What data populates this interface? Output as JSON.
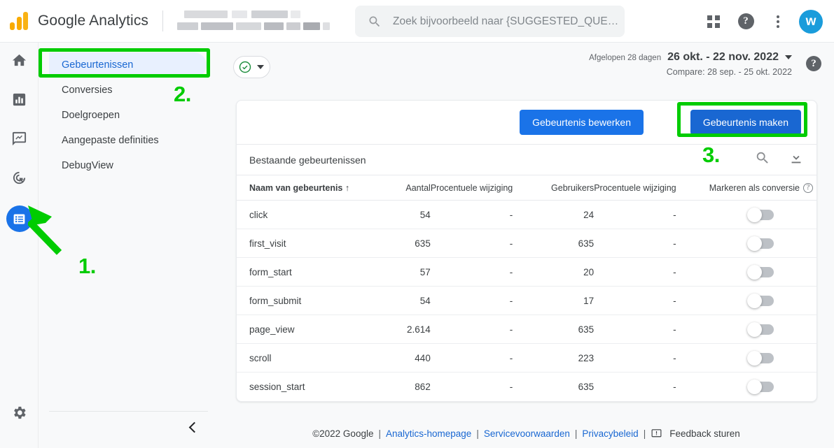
{
  "header": {
    "product_title": "Google Analytics",
    "logo_icon": "google-analytics-logo",
    "account_blurred": true,
    "search": {
      "icon": "search-icon",
      "placeholder": "Zoek bijvoorbeeld naar {SUGGESTED_QUE…"
    },
    "apps_icon": "apps-grid-icon",
    "help_icon": "help-circle-icon",
    "more_icon": "more-vertical-icon",
    "avatar_initial": "w",
    "avatar_color": "#1a9cdb"
  },
  "rail": {
    "items": [
      {
        "name": "home",
        "icon": "home-icon",
        "active": false
      },
      {
        "name": "reports",
        "icon": "bar-chart-icon",
        "active": false
      },
      {
        "name": "explore",
        "icon": "explore-trend-icon",
        "active": false
      },
      {
        "name": "advertising",
        "icon": "advertising-target-icon",
        "active": false
      },
      {
        "name": "configure",
        "icon": "list-config-icon",
        "active": true
      }
    ],
    "settings_icon": "gear-icon",
    "active_color": "#1a73e8"
  },
  "nav": {
    "items": [
      {
        "label": "Gebeurtenissen",
        "active": true
      },
      {
        "label": "Conversies",
        "active": false
      },
      {
        "label": "Doelgroepen",
        "active": false
      },
      {
        "label": "Aangepaste definities",
        "active": false
      },
      {
        "label": "DebugView",
        "active": false
      }
    ],
    "collapse_icon": "chevron-left-icon",
    "active_bg": "#e8f0fe",
    "active_text": "#1967d2"
  },
  "toolbar": {
    "filter_chip": {
      "check_icon": "check-circle-icon",
      "dropdown_icon": "chevron-down-icon"
    },
    "date_range": {
      "preset_label": "Afgelopen 28 dagen",
      "range": "26 okt. - 22 nov. 2022",
      "dropdown_icon": "chevron-down-icon",
      "compare": "Compare: 28 sep. - 25 okt. 2022"
    },
    "help_icon": "help-circle-icon"
  },
  "card": {
    "edit_event_button": "Gebeurtenis bewerken",
    "create_event_button": "Gebeurtenis maken",
    "section_title": "Bestaande gebeurtenissen",
    "search_icon": "search-icon",
    "download_icon": "download-icon",
    "button_primary_color": "#1a73e8",
    "button_secondary_color": "#1967d2"
  },
  "table": {
    "columns": [
      "Naam van gebeurtenis",
      "Aantal",
      "Procentuele wijziging",
      "Gebruikers",
      "Procentuele wijziging",
      "Markeren als conversie"
    ],
    "sort_icon": "arrow-up-icon",
    "conversion_help_icon": "question-badge-icon",
    "rows": [
      {
        "name": "click",
        "count": "54",
        "change1": "-",
        "users": "24",
        "change2": "-",
        "conversion": false
      },
      {
        "name": "first_visit",
        "count": "635",
        "change1": "-",
        "users": "635",
        "change2": "-",
        "conversion": false
      },
      {
        "name": "form_start",
        "count": "57",
        "change1": "-",
        "users": "20",
        "change2": "-",
        "conversion": false
      },
      {
        "name": "form_submit",
        "count": "54",
        "change1": "-",
        "users": "17",
        "change2": "-",
        "conversion": false
      },
      {
        "name": "page_view",
        "count": "2.614",
        "change1": "-",
        "users": "635",
        "change2": "-",
        "conversion": false
      },
      {
        "name": "scroll",
        "count": "440",
        "change1": "-",
        "users": "223",
        "change2": "-",
        "conversion": false
      },
      {
        "name": "session_start",
        "count": "862",
        "change1": "-",
        "users": "635",
        "change2": "-",
        "conversion": false
      }
    ]
  },
  "footer": {
    "copyright": "©2022 Google",
    "links": [
      "Analytics-homepage",
      "Servicevoorwaarden",
      "Privacybeleid"
    ],
    "separator": "|",
    "feedback_icon": "feedback-icon",
    "feedback_label": "Feedback sturen"
  },
  "annotations": {
    "color": "#00cc00",
    "step1": "1.",
    "step2": "2.",
    "step3": "3.",
    "arrow_icon": "arrow-up-left-icon"
  }
}
